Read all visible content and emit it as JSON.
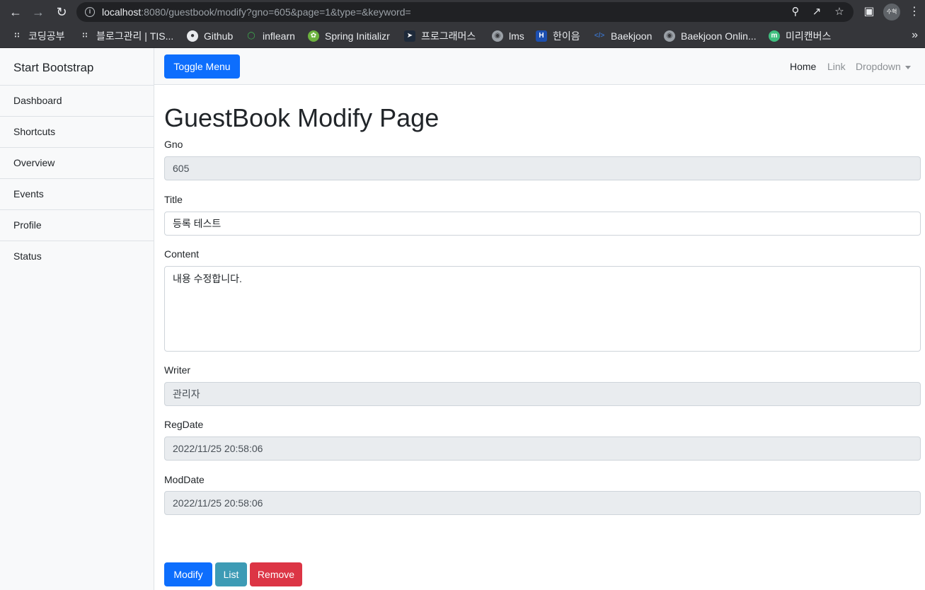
{
  "browser": {
    "url_host": "localhost",
    "url_rest": ":8080/guestbook/modify?gno=605&page=1&type=&keyword=",
    "avatar_text": "수혁",
    "bookmarks": [
      {
        "label": "코딩공부",
        "icon": "tistory-icon"
      },
      {
        "label": "블로그관리 | TIS...",
        "icon": "tistory-icon"
      },
      {
        "label": "Github",
        "icon": "github-icon"
      },
      {
        "label": "inflearn",
        "icon": "inflearn-icon"
      },
      {
        "label": "Spring Initializr",
        "icon": "spring-icon"
      },
      {
        "label": "프로그래머스",
        "icon": "programmers-icon"
      },
      {
        "label": "lms",
        "icon": "globe-icon"
      },
      {
        "label": "한이음",
        "icon": "hanium-icon"
      },
      {
        "label": "Baekjoon",
        "icon": "code-icon"
      },
      {
        "label": "Baekjoon Onlin...",
        "icon": "globe-icon"
      },
      {
        "label": "미리캔버스",
        "icon": "miricanvas-icon"
      }
    ],
    "more_label": "»"
  },
  "sidebar": {
    "heading": "Start Bootstrap",
    "items": [
      "Dashboard",
      "Shortcuts",
      "Overview",
      "Events",
      "Profile",
      "Status"
    ]
  },
  "topnav": {
    "toggle_label": "Toggle Menu",
    "links": [
      "Home",
      "Link",
      "Dropdown"
    ]
  },
  "form": {
    "title": "GuestBook Modify Page",
    "gno_label": "Gno",
    "gno_value": "605",
    "title_label": "Title",
    "title_value": "등록 테스트",
    "content_label": "Content",
    "content_value": "내용 수정합니다.",
    "writer_label": "Writer",
    "writer_value": "관리자",
    "regdate_label": "RegDate",
    "regdate_value": "2022/11/25 20:58:06",
    "moddate_label": "ModDate",
    "moddate_value": "2022/11/25 20:58:06",
    "modify_label": "Modify",
    "list_label": "List",
    "remove_label": "Remove"
  },
  "colors": {
    "primary": "#0d6efd",
    "info": "#3d9bb5",
    "danger": "#dc3545"
  }
}
